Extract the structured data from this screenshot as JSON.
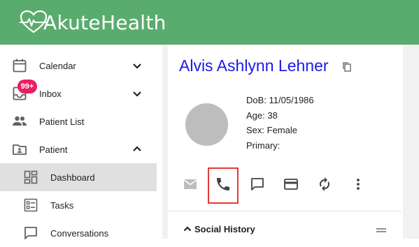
{
  "app": {
    "brand_name": "AkuteHealth"
  },
  "sidebar": {
    "items": [
      {
        "label": "Calendar"
      },
      {
        "label": "Inbox",
        "badge": "99+"
      },
      {
        "label": "Patient List"
      },
      {
        "label": "Patient"
      },
      {
        "label": "Dashboard"
      },
      {
        "label": "Tasks"
      },
      {
        "label": "Conversations"
      }
    ]
  },
  "patient": {
    "name": "Alvis Ashlynn Lehner",
    "dob_label": "DoB:",
    "dob": "11/05/1986",
    "age_label": "Age:",
    "age": "38",
    "sex_label": "Sex:",
    "sex": "Female",
    "primary_label": "Primary:",
    "primary": ""
  },
  "actions": {
    "icons": [
      "email-icon",
      "phone-icon",
      "message-icon",
      "credit-card-icon",
      "sync-icon",
      "more-vert-icon"
    ]
  },
  "sections": {
    "social_history_label": "Social History"
  },
  "colors": {
    "header": "#5aac6e",
    "name": "#1a1ae6",
    "badge": "#e91e63",
    "highlight": "#e53935",
    "active_nav": "#e0e0e0"
  }
}
